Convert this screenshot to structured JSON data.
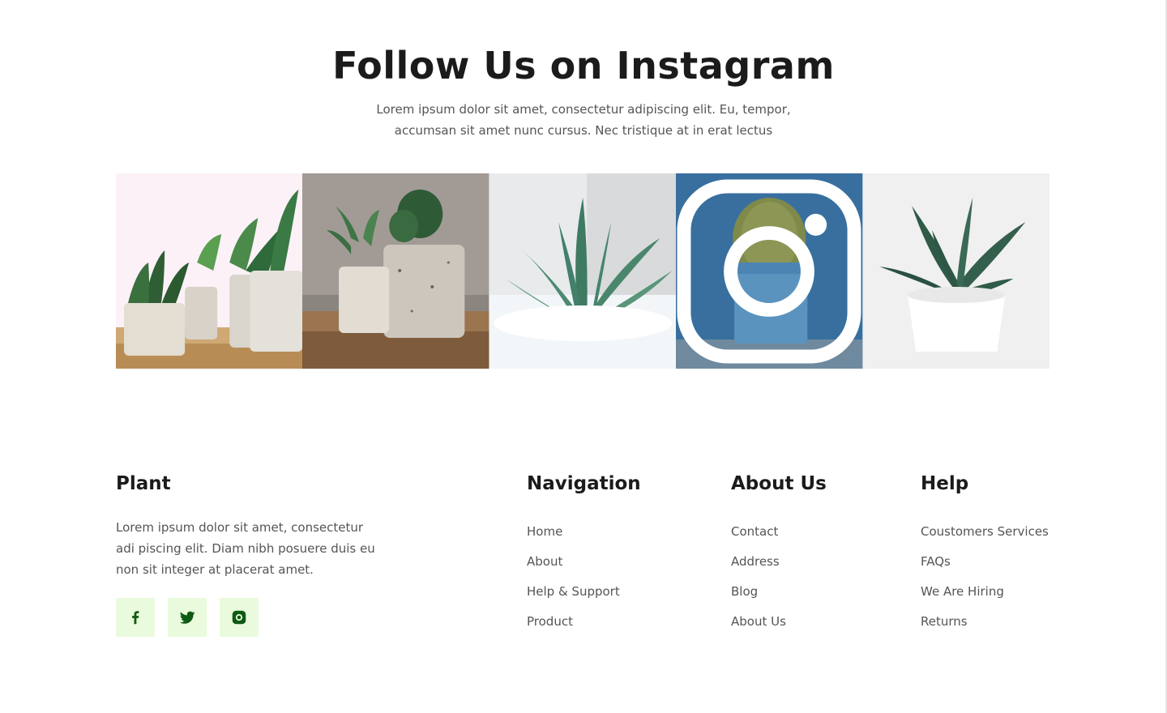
{
  "instagram": {
    "title": "Follow Us on Instagram",
    "description": "Lorem ipsum dolor sit amet, consectetur adipiscing elit. Eu, tempor, accumsan sit amet nunc cursus. Nec tristique at in erat lectus",
    "tiles": [
      {
        "name": "plants-on-table"
      },
      {
        "name": "cactus-pots"
      },
      {
        "name": "aloe-closeup"
      },
      {
        "name": "cactus-blue"
      },
      {
        "name": "haworthia-white-pot"
      }
    ]
  },
  "footer": {
    "brand": {
      "title": "Plant",
      "description": "Lorem ipsum dolor sit amet, consectetur adi piscing elit. Diam nibh posuere duis eu non sit integer at placerat amet.",
      "socials": [
        "facebook-icon",
        "twitter-icon",
        "instagram-icon"
      ]
    },
    "navigation": {
      "title": "Navigation",
      "links": [
        "Home",
        "About",
        "Help & Support",
        "Product"
      ]
    },
    "about": {
      "title": "About Us",
      "links": [
        "Contact",
        "Address",
        "Blog",
        "About Us"
      ]
    },
    "help": {
      "title": "Help",
      "links": [
        "Coustomers Services",
        "FAQs",
        "We Are Hiring",
        "Returns"
      ]
    }
  },
  "colors": {
    "social_bg": "#e9fbdc",
    "social_icon": "#0e5a12",
    "heading": "#1b1b1b",
    "body_text": "#555555"
  }
}
